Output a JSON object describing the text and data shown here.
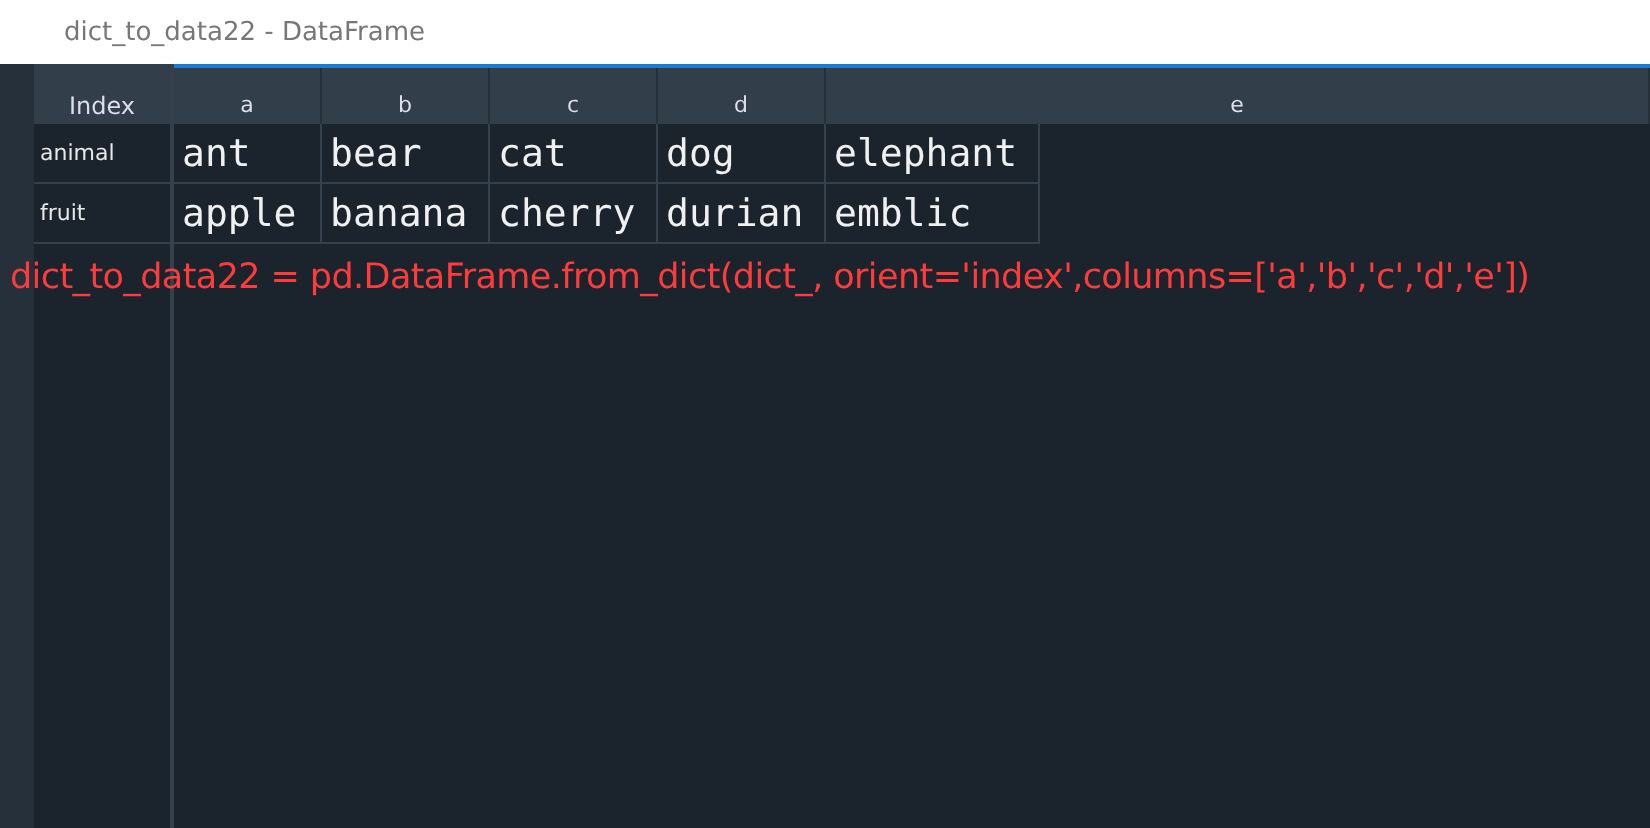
{
  "window": {
    "title": "dict_to_data22 - DataFrame"
  },
  "table": {
    "index_header": "Index",
    "columns": [
      "a",
      "b",
      "c",
      "d",
      "e"
    ],
    "rows": [
      {
        "index": "animal",
        "cells": [
          "ant",
          "bear",
          "cat",
          "dog",
          "elephant"
        ]
      },
      {
        "index": "fruit",
        "cells": [
          "apple",
          "banana",
          "cherry",
          "durian",
          "emblic"
        ]
      }
    ]
  },
  "annotation": "dict_to_data22 = pd.DataFrame.from_dict(dict_, orient='index',columns=['a','b','c','d','e'])"
}
